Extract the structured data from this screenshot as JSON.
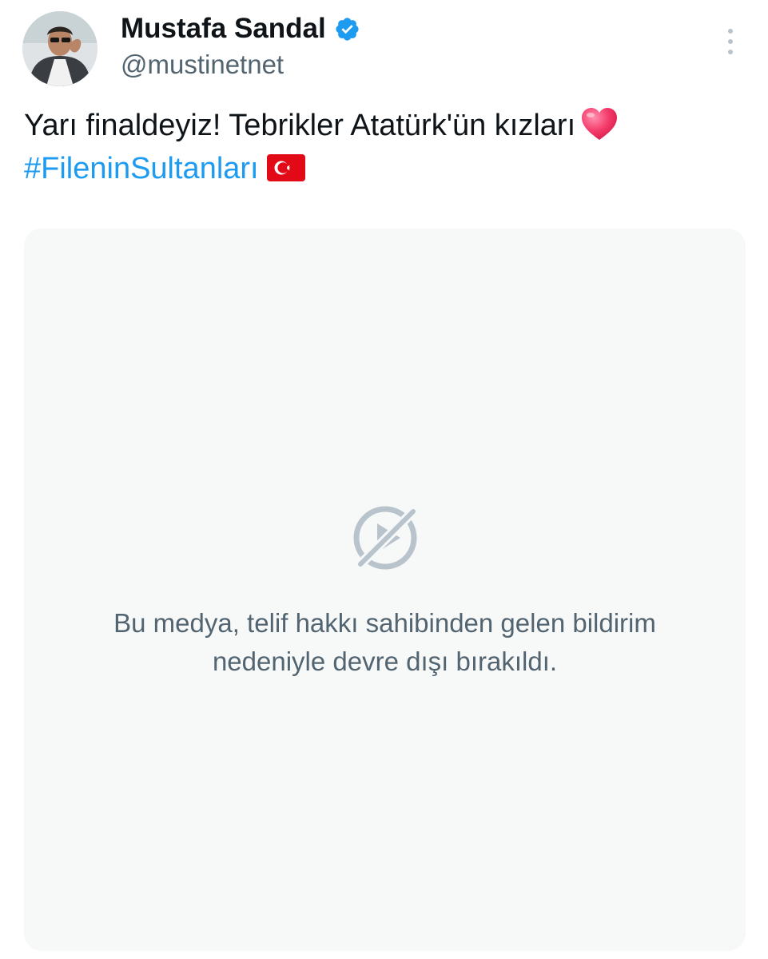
{
  "tweet": {
    "author": {
      "name": "Mustafa Sandal",
      "handle": "@mustinetnet",
      "verified": true,
      "avatar": "profile-photo"
    },
    "text": {
      "line1": "Yarı finaldeyiz! Tebrikler Atatürk'ün kızları",
      "line1_emoji": "heart-emoji",
      "hashtag": "#FileninSultanları",
      "line2_emoji": "turkey-flag-emoji"
    },
    "media": {
      "icon": "media-disabled-icon",
      "message_line1": "Bu medya, telif hakkı sahibinden gelen bildirim",
      "message_line2": "nedeniyle devre dışı bırakıldı."
    },
    "more_icon": "more-vertical-icon"
  },
  "colors": {
    "accent": "#1d9bf0",
    "text_primary": "#0f1419",
    "text_secondary": "#536471",
    "media_bg": "#f7f9f9",
    "icon_muted": "#b9c3cc"
  }
}
